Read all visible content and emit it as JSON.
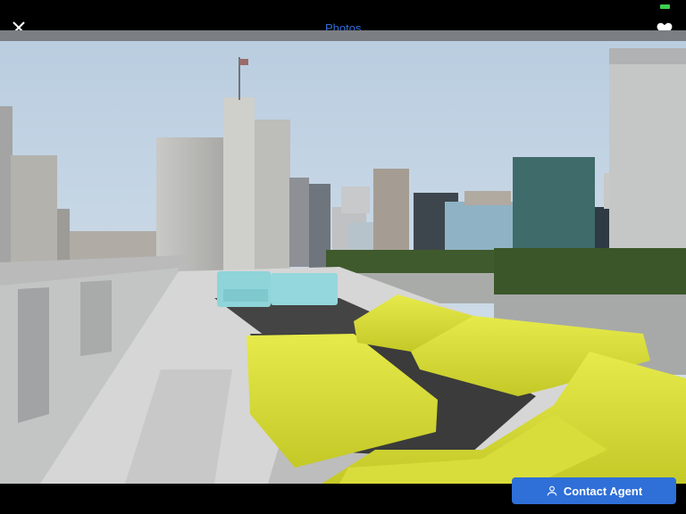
{
  "header": {
    "tab_label": "Photos"
  },
  "footer": {
    "contact_label": "Contact Agent"
  },
  "colors": {
    "accent": "#2e6fd6",
    "battery": "#3ecf4e"
  },
  "icons": {
    "close": "close-icon",
    "favorite": "heart-icon",
    "contact": "user-icon"
  }
}
